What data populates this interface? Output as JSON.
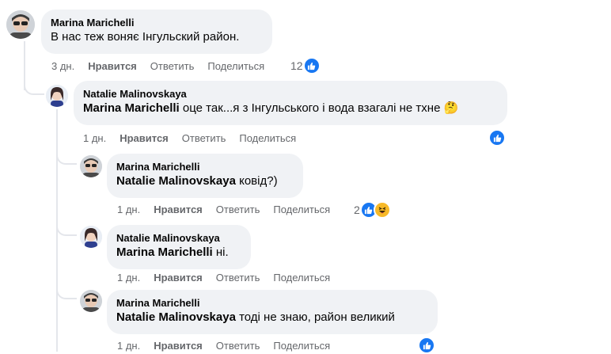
{
  "comments": [
    {
      "author": "Marina Marichelli",
      "mention": "",
      "text": "В нас теж воняє Інгульский район.",
      "time": "3 дн.",
      "like": "Нравится",
      "reply": "Ответить",
      "share": "Поделиться",
      "reaction_count": "12",
      "reactions": [
        "like-icon"
      ]
    },
    {
      "author": "Natalie Malinovskaya",
      "mention": "Marina Marichelli",
      "text": "оце так...я з Інгульського і вода взагалі не тхне",
      "emoji": "🤔",
      "time": "1 дн.",
      "like": "Нравится",
      "reply": "Ответить",
      "share": "Поделиться",
      "reaction_count": "",
      "reactions": [
        "like-icon"
      ]
    },
    {
      "author": "Marina Marichelli",
      "mention": "Natalie Malinovskaya",
      "text": "ковід?)",
      "time": "1 дн.",
      "like": "Нравится",
      "reply": "Ответить",
      "share": "Поделиться",
      "reaction_count": "2",
      "reactions": [
        "like-icon",
        "haha-icon"
      ]
    },
    {
      "author": "Natalie Malinovskaya",
      "mention": "Marina Marichelli",
      "text": "ні.",
      "time": "1 дн.",
      "like": "Нравится",
      "reply": "Ответить",
      "share": "Поделиться",
      "reaction_count": "",
      "reactions": []
    },
    {
      "author": "Marina Marichelli",
      "mention": "Natalie Malinovskaya",
      "text": "тоді не знаю, район великий",
      "time": "1 дн.",
      "like": "Нравится",
      "reply": "Ответить",
      "share": "Поделиться",
      "reaction_count": "",
      "reactions": [
        "like-icon"
      ]
    }
  ],
  "colors": {
    "bubble": "#f0f2f5",
    "accent_like": "#1877f2",
    "muted": "#65676b"
  }
}
